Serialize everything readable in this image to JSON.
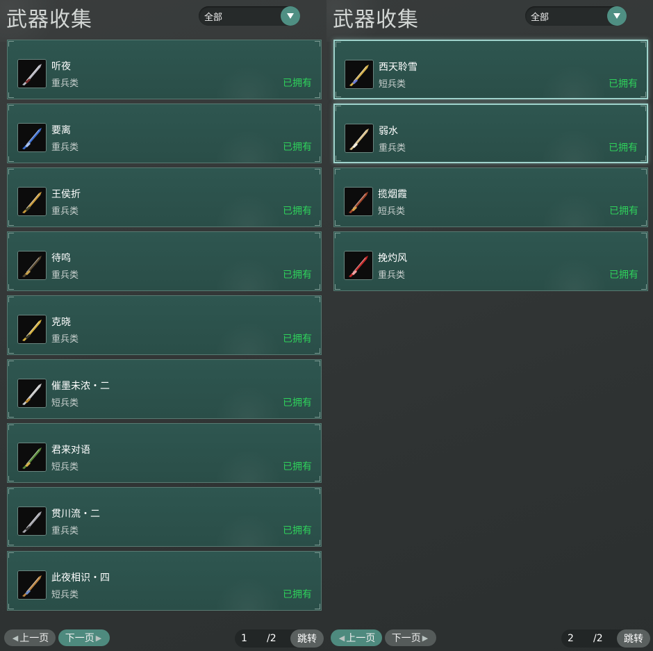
{
  "panels": [
    {
      "title": "武器收集",
      "filter": "全部",
      "items": [
        {
          "name": "听夜",
          "type": "重兵类",
          "status": "已拥有",
          "icon": "heavy-blade-silver-icon",
          "color": "#b9b9c2",
          "accent": "#7a2b2b"
        },
        {
          "name": "要离",
          "type": "重兵类",
          "status": "已拥有",
          "icon": "heavy-blade-blue-icon",
          "color": "#3d6fd0",
          "accent": "#a9c4f2"
        },
        {
          "name": "王侯折",
          "type": "重兵类",
          "status": "已拥有",
          "icon": "heavy-blade-gold-icon",
          "color": "#c89a3a",
          "accent": "#4a4a2a"
        },
        {
          "name": "待鸣",
          "type": "重兵类",
          "status": "已拥有",
          "icon": "heavy-blade-dark-icon",
          "color": "#5a4a30",
          "accent": "#c9a24a"
        },
        {
          "name": "克晓",
          "type": "重兵类",
          "status": "已拥有",
          "icon": "heavy-blade-yellow-icon",
          "color": "#d6b23e",
          "accent": "#3a3a2a"
        },
        {
          "name": "催墨未浓・二",
          "type": "短兵类",
          "status": "已拥有",
          "icon": "short-sword-silver-icon",
          "color": "#c9c9c9",
          "accent": "#b8862a"
        },
        {
          "name": "君来对语",
          "type": "短兵类",
          "status": "已拥有",
          "icon": "short-sword-green-icon",
          "color": "#5a8a3a",
          "accent": "#d9b24a"
        },
        {
          "name": "贯川流・二",
          "type": "重兵类",
          "status": "已拥有",
          "icon": "heavy-blade-steel-icon",
          "color": "#a6a6ae",
          "accent": "#3a3a3a"
        },
        {
          "name": "此夜相识・四",
          "type": "短兵类",
          "status": "已拥有",
          "icon": "short-sword-bronze-icon",
          "color": "#b9823e",
          "accent": "#6a8ac9"
        }
      ],
      "pager": {
        "prev": "上一页",
        "next": "下一页",
        "page": "1",
        "total": "/2",
        "jump": "跳转",
        "active": "next"
      }
    },
    {
      "title": "武器收集",
      "filter": "全部",
      "items": [
        {
          "name": "西天聆雪",
          "type": "短兵类",
          "status": "已拥有",
          "icon": "short-sword-ornate-icon",
          "color": "#d4b04a",
          "accent": "#6a7ad6",
          "selected": true
        },
        {
          "name": "弱水",
          "type": "重兵类",
          "status": "已拥有",
          "icon": "heavy-blade-gold-white-icon",
          "color": "#d9c08a",
          "accent": "#f4efe2",
          "selected": true
        },
        {
          "name": "揽烟霞",
          "type": "短兵类",
          "status": "已拥有",
          "icon": "short-sword-red-icon",
          "color": "#a2452a",
          "accent": "#d9a24a"
        },
        {
          "name": "挽灼风",
          "type": "重兵类",
          "status": "已拥有",
          "icon": "heavy-blade-crimson-icon",
          "color": "#c42a2a",
          "accent": "#f2a2a2"
        }
      ],
      "pager": {
        "prev": "上一页",
        "next": "下一页",
        "page": "2",
        "total": "/2",
        "jump": "跳转",
        "active": "prev"
      }
    }
  ]
}
